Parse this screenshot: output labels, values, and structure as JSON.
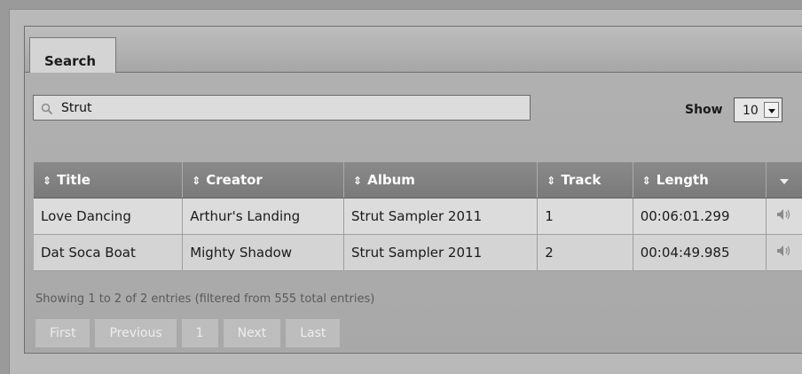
{
  "tab": {
    "label": "Search"
  },
  "search": {
    "value": "Strut"
  },
  "page_size": {
    "label": "Show",
    "value": "10"
  },
  "table": {
    "headers": [
      "Title",
      "Creator",
      "Album",
      "Track",
      "Length"
    ],
    "rows": [
      [
        "Love Dancing",
        "Arthur's Landing",
        "Strut Sampler 2011",
        "1",
        "00:06:01.299"
      ],
      [
        "Dat Soca Boat",
        "Mighty Shadow",
        "Strut Sampler 2011",
        "2",
        "00:04:49.985"
      ]
    ]
  },
  "info": "Showing 1 to 2 of 2 entries (filtered from 555 total entries)",
  "pager": {
    "first": "First",
    "previous": "Previous",
    "page": "1",
    "next": "Next",
    "last": "Last"
  },
  "icons": {
    "search": "search-icon",
    "sort": "sort-icon",
    "play": "speaker-icon",
    "menu": "dropdown-arrow-icon"
  }
}
